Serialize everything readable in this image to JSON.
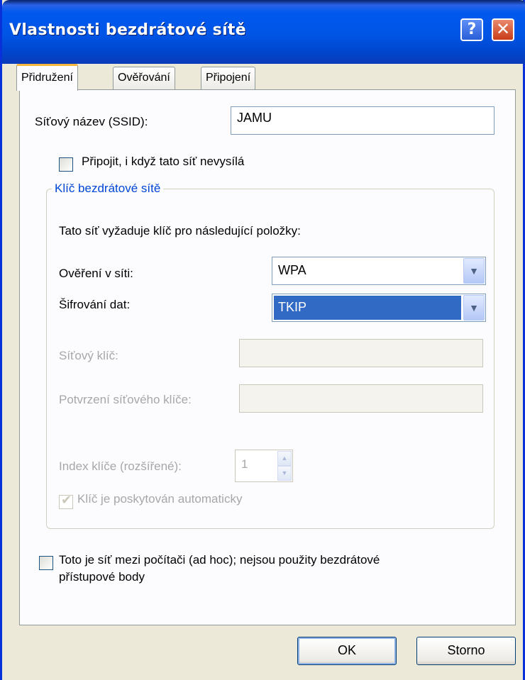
{
  "window": {
    "title": "Vlastnosti bezdrátové sítě",
    "help_glyph": "?",
    "close_glyph": "✕"
  },
  "tabs": [
    {
      "label": "Přidružení",
      "active": true
    },
    {
      "label": "Ověřování"
    },
    {
      "label": "Připojení"
    }
  ],
  "ssid": {
    "label": "Síťový název (SSID):",
    "value": "JAMU"
  },
  "connect_hidden": {
    "label": "Připojit, i když tato síť nevysílá",
    "checked": false
  },
  "key_group": {
    "title": "Klíč bezdrátové sítě",
    "intro": "Tato síť vyžaduje klíč pro následující položky:",
    "auth": {
      "label": "Ověření v síti:",
      "value": "WPA"
    },
    "encryption": {
      "label": "Šifrování dat:",
      "value": "TKIP"
    },
    "network_key": {
      "label": "Síťový klíč:",
      "value": ""
    },
    "confirm_key": {
      "label": "Potvrzení síťového klíče:",
      "value": ""
    },
    "key_index": {
      "label": "Index klíče (rozšířené):",
      "value": "1"
    },
    "auto_key": {
      "label": "Klíč je poskytován automaticky",
      "checked": true,
      "enabled": false
    }
  },
  "adhoc": {
    "line1": "Toto je síť mezi počítači (ad hoc); nejsou použity bezdrátové",
    "line2": "přístupové body",
    "checked": false
  },
  "buttons": {
    "ok": "OK",
    "cancel": "Storno"
  },
  "colors": {
    "titlebar": "#0055E5",
    "accent_tab": "#F7B53D",
    "group_title": "#0046D5",
    "selection": "#316AC5",
    "face": "#ECE9D8"
  }
}
